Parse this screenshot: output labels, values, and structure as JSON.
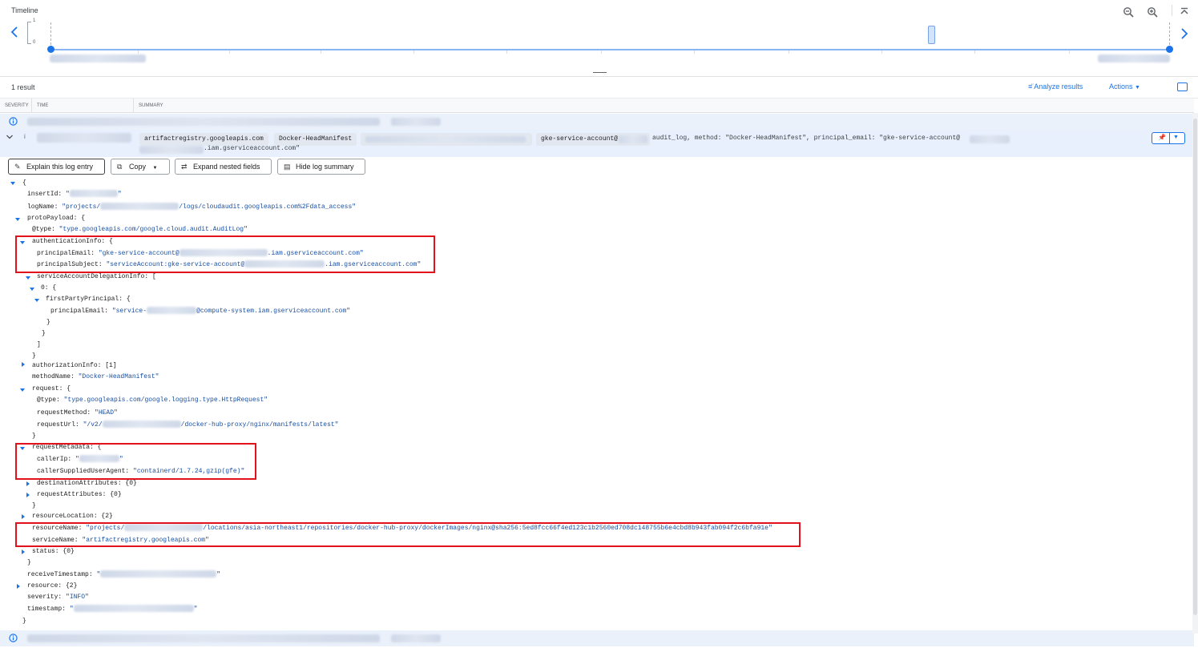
{
  "timeline": {
    "title": "Timeline",
    "y_max": "1",
    "y_min": "0",
    "icons": [
      "zoom-out-icon",
      "zoom-in-icon",
      "collapse-icon",
      "prev-icon",
      "next-icon"
    ]
  },
  "results": {
    "count": "1 result",
    "analyze_label": "Analyze results",
    "actions_label": "Actions"
  },
  "columns": [
    "SEVERITY",
    "TIME",
    "SUMMARY"
  ],
  "entry": {
    "chips": [
      "artifactregistry.googleapis.com",
      "Docker-HeadManifest",
      "gke-service-account@"
    ],
    "summary_line1": "audit_log, method: \"Docker-HeadManifest\", principal_email: \"gke-service-account@",
    "summary_line2": ".iam.gserviceaccount.com\""
  },
  "buttons": {
    "explain": "Explain this log entry",
    "copy": "Copy",
    "expand": "Expand nested fields",
    "hide": "Hide log summary"
  },
  "json": {
    "open_brace": "{",
    "insertId_key": "insertId:",
    "logName_key": "logName:",
    "logName_pre": "\"projects/",
    "logName_post": "/logs/cloudaudit.googleapis.com%2Fdata_access\"",
    "protoPayload_key": "protoPayload: {",
    "type_key": "@type:",
    "type_val": "\"type.googleapis.com/google.cloud.audit.AuditLog\"",
    "authInfo_key": "authenticationInfo: {",
    "principalEmail_key": "principalEmail:",
    "principalEmail_pre": "\"gke-service-account@",
    "principalEmail_post": ".iam.gserviceaccount.com\"",
    "principalSubject_key": "principalSubject:",
    "principalSubject_pre": "\"serviceAccount:gke-service-account@",
    "principalSubject_post": ".iam.gserviceaccount.com\"",
    "sadi_key": "serviceAccountDelegationInfo: [",
    "zero_key": "0: {",
    "fpp_key": "firstPartyPrincipal: {",
    "fpp_email_key": "principalEmail:",
    "fpp_email_pre": "\"service-",
    "fpp_email_post": "@compute-system.iam.gserviceaccount.com\"",
    "close_brace": "}",
    "close_bracket": "]",
    "authzInfo_key": "authorizationInfo: [1]",
    "methodName_key": "methodName:",
    "methodName_val": "\"Docker-HeadManifest\"",
    "request_key": "request: {",
    "req_type_key": "@type:",
    "req_type_val": "\"type.googleapis.com/google.logging.type.HttpRequest\"",
    "requestMethod_key": "requestMethod:",
    "requestMethod_val": "\"HEAD\"",
    "requestUrl_key": "requestUrl:",
    "requestUrl_pre": "\"/v2/",
    "requestUrl_post": "/docker-hub-proxy/nginx/manifests/latest\"",
    "reqMeta_key": "requestMetadata: {",
    "callerIp_key": "callerIp:",
    "callerIp_pre": "\"",
    "callerIp_post": "\"",
    "ua_key": "callerSuppliedUserAgent:",
    "ua_val": "\"containerd/1.7.24,gzip(gfe)\"",
    "destAttr_key": "destinationAttributes: {0}",
    "reqAttr_key": "requestAttributes: {0}",
    "resLoc_key": "resourceLocation: {2}",
    "resourceName_key": "resourceName:",
    "resourceName_pre": "\"projects/",
    "resourceName_post": "/locations/asia-northeast1/repositories/docker-hub-proxy/dockerImages/nginx@sha256:5ed8fcc66f4ed123c1b2560ed708dc148755b6e4cbd8b943fab094f2c6bfa91e\"",
    "serviceName_key": "serviceName:",
    "serviceName_val": "\"artifactregistry.googleapis.com\"",
    "status_key": "status: {0}",
    "receiveTs_key": "receiveTimestamp:",
    "receiveTs_pre": "\"",
    "receiveTs_post": "\"",
    "resource_key": "resource: {2}",
    "severity_key": "severity:",
    "severity_val": "\"INFO\"",
    "timestamp_key": "timestamp:",
    "timestamp_pre": "\"",
    "timestamp_post": "\""
  },
  "colors": {
    "accent": "#1a73e8",
    "highlight": "#e3111b",
    "row_bg": "#e8f0fe"
  }
}
